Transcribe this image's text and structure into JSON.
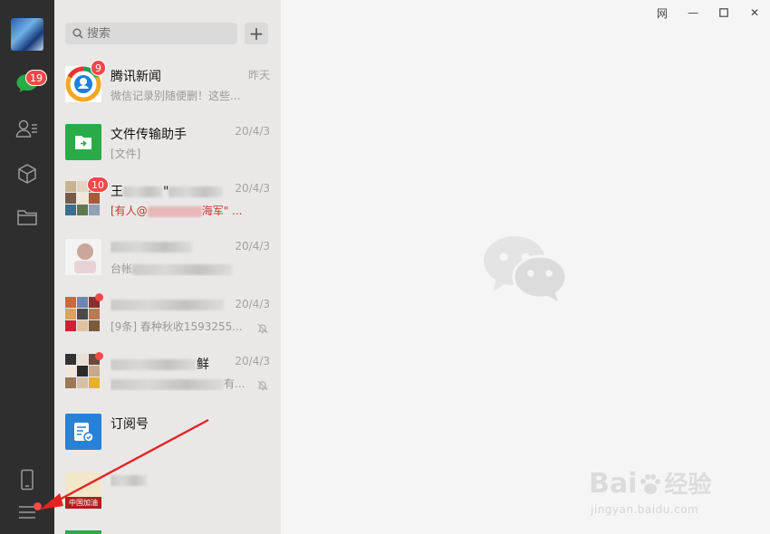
{
  "window": {
    "controls": [
      "pin-icon",
      "minimize-icon",
      "maximize-icon",
      "close-icon"
    ],
    "pin_label": "⽹",
    "minimize_label": "—",
    "close_label": "✕"
  },
  "sidebar": {
    "chat_badge": "19",
    "items": [
      "chat-icon",
      "contacts-icon",
      "mini-program-icon",
      "folder-icon"
    ],
    "bottom": [
      "phone-icon",
      "menu-icon"
    ]
  },
  "search": {
    "placeholder": "搜索",
    "add_label": "+"
  },
  "chats": [
    {
      "name": "腾讯新闻",
      "time": "昨天",
      "snippet": "微信记录别随便删！这些...",
      "badge": "9"
    },
    {
      "name": "文件传输助手",
      "time": "20/4/3",
      "snippet": "[文件]"
    },
    {
      "name_visible": "王",
      "name_tail": "\"",
      "time": "20/4/3",
      "snippet_prefix": "[有人@",
      "snippet_tail": "海军\" ...",
      "badge": "10"
    },
    {
      "time": "20/4/3",
      "snippet_prefix": "台帐"
    },
    {
      "time": "20/4/3",
      "snippet": "[9条] 春种秋收1593255..."
    },
    {
      "name_tail": "鲜",
      "time": "20/4/3",
      "snippet_tail": "有..."
    },
    {
      "name": "订阅号"
    },
    {
      "thumb_text": "中国加油"
    }
  ],
  "colors": {
    "rail": "#2e2e2e",
    "list": "#e9e8e7",
    "main": "#f5f5f5",
    "badge": "#f04a4a",
    "accent": "#29ab48",
    "arrow": "#e52222"
  },
  "watermark": {
    "brand": "Bai",
    "brand_tail": "经验",
    "sub": "jingyan.baidu.com"
  }
}
